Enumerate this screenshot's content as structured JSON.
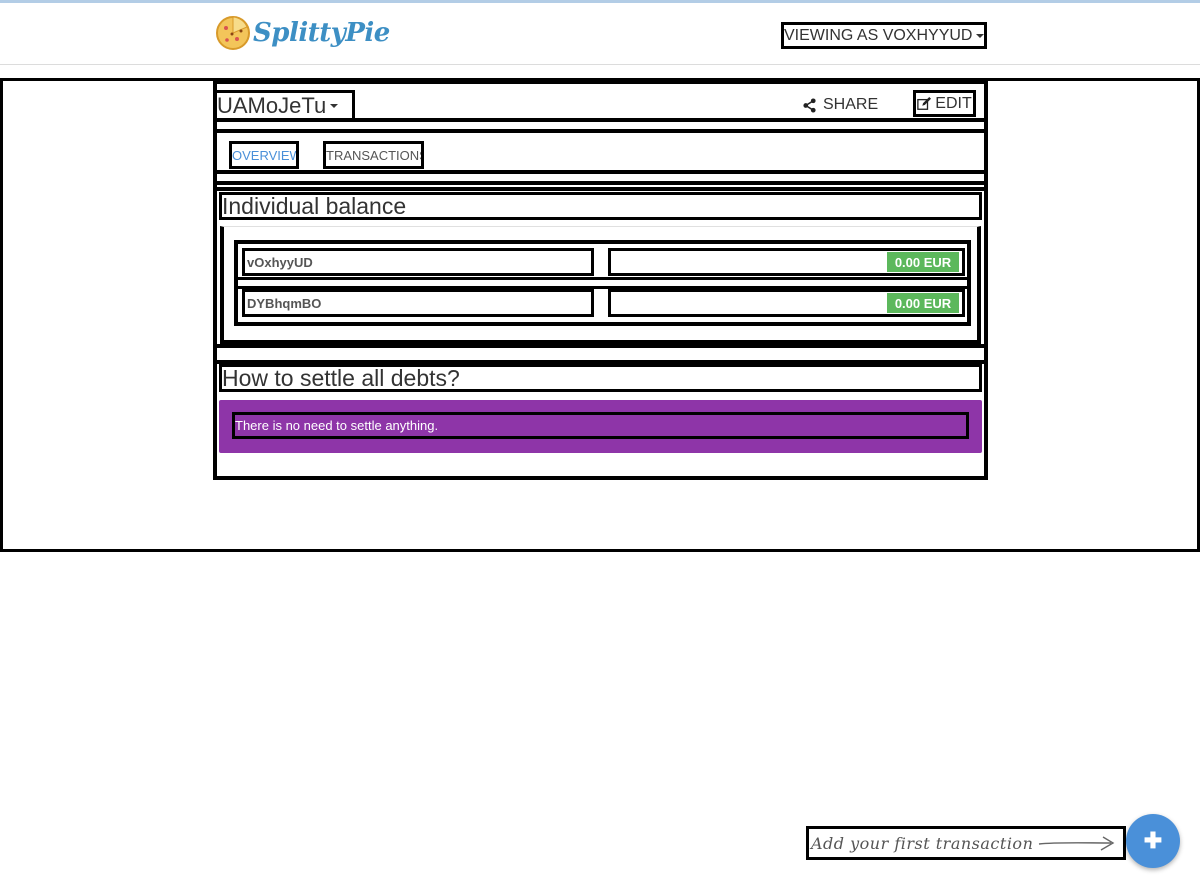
{
  "app": {
    "brand_name": "SplittyPie",
    "viewing_as": "VIEWING AS VOXHYYUD"
  },
  "project": {
    "title": "UAMoJeTu",
    "share_label": "SHARE",
    "edit_label": "EDIT",
    "tabs": [
      {
        "label": "OVERVIEW",
        "active": true
      },
      {
        "label": "TRANSACTIONS",
        "active": false
      }
    ]
  },
  "balance": {
    "heading": "Individual balance",
    "rows": [
      {
        "name": "vOxhyyUD",
        "amount": "0.00 EUR"
      },
      {
        "name": "DYBhqmBO",
        "amount": "0.00 EUR"
      }
    ]
  },
  "settle": {
    "heading": "How to settle all debts?",
    "message": "There is no need to settle anything."
  },
  "fab": {
    "hint": "Add your first transaction",
    "icon": "plus-icon"
  },
  "colors": {
    "accent": "#4a90d9",
    "brand": "#3d8fc4",
    "positive_badge": "#5cb85c",
    "settle_panel": "#8e35a8"
  }
}
